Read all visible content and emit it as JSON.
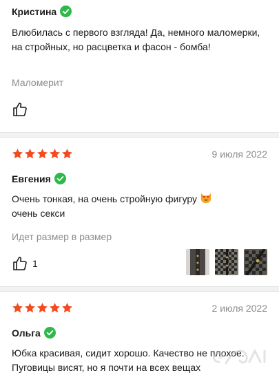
{
  "reviews": [
    {
      "author": "Кристина",
      "text": "Влюбилась с первого взгляда! Да, немного маломерки, на стройных, но расцветка и фасон - бомба!",
      "fit": "Маломерит",
      "likes": ""
    },
    {
      "date": "9 июля 2022",
      "rating": 5,
      "author": "Евгения",
      "text_line1": "Очень тонкая, на очень стройную фигуру",
      "text_line2": "очень секси",
      "fit": "Идет размер в размер",
      "likes": "1"
    },
    {
      "date": "2 июля 2022",
      "rating": 5,
      "author": "Ольга",
      "text": "Юбка красивая, сидит хорошо. Качество не плохое. Пуговицы висят, но я почти на всех вещах"
    }
  ],
  "colors": {
    "star": "#f24b1f",
    "verified": "#2fb94a",
    "muted": "#8c8c8c"
  },
  "icons": {
    "verified": "verified-check-icon",
    "like": "thumbs-up-icon",
    "star": "star-icon",
    "emoji": "heart-eyes-cat-emoji"
  }
}
